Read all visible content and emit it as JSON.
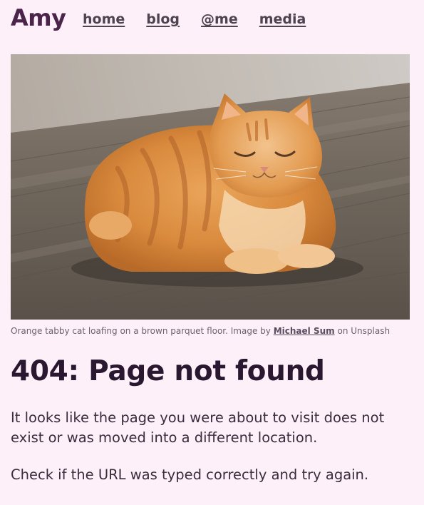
{
  "header": {
    "brand": "Amy",
    "nav": [
      {
        "label": "home"
      },
      {
        "label": "blog"
      },
      {
        "label": "@me"
      },
      {
        "label": "media"
      }
    ]
  },
  "figure": {
    "caption_prefix": "Orange tabby cat loafing on a brown parquet floor. Image by",
    "caption_author": "Michael Sum",
    "caption_suffix": "on Unsplash"
  },
  "main": {
    "title": "404: Page not found",
    "paragraph1": "It looks like the page you were about to visit does not exist or was moved into a different location.",
    "paragraph2": "Check if the URL was typed correctly and try again."
  },
  "colors": {
    "background": "#fdf0f9",
    "brand": "#4b2449",
    "text": "#3c2c3e"
  }
}
